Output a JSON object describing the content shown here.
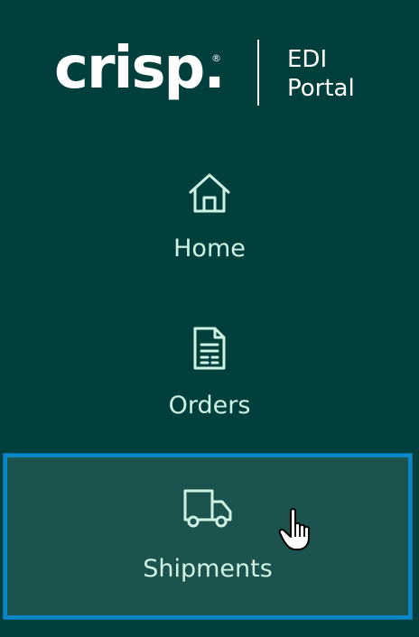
{
  "brand": {
    "logo_text": "crisp.",
    "registered_mark": "®",
    "subtitle_line1": "EDI",
    "subtitle_line2": "Portal"
  },
  "nav": {
    "items": [
      {
        "label": "Home",
        "icon": "home-icon"
      },
      {
        "label": "Orders",
        "icon": "document-icon"
      },
      {
        "label": "Shipments",
        "icon": "truck-icon",
        "active": true
      }
    ]
  },
  "colors": {
    "background": "#003f3c",
    "item_text": "#cff3e3",
    "active_background": "#1d534e",
    "focus_ring": "#0b86c7"
  },
  "cursor": "pointer-hand-icon"
}
